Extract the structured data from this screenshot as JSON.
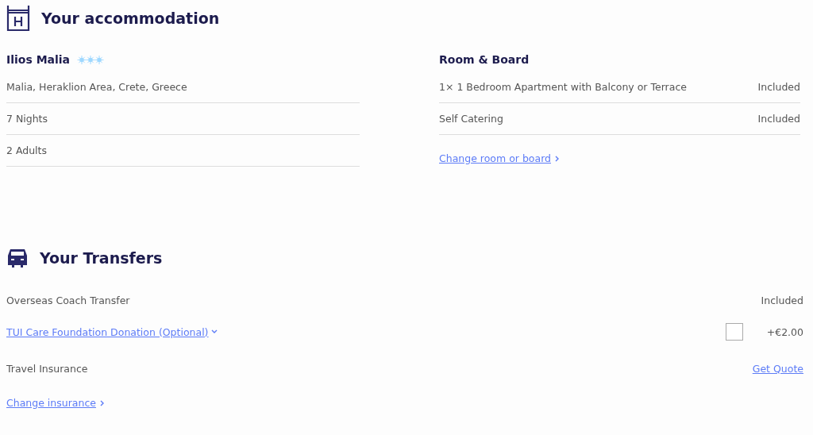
{
  "accommodation": {
    "title": "Your accommodation",
    "hotel": {
      "name": "Ilios Malia",
      "stars": 3
    },
    "details": [
      "Malia, Heraklion Area, Crete, Greece",
      "7 Nights",
      "2  Adults"
    ],
    "room_board": {
      "title": "Room & Board",
      "rows": [
        {
          "label": "1× 1 Bedroom Apartment with Balcony or Terrace",
          "value": "Included"
        },
        {
          "label": "Self Catering",
          "value": "Included"
        }
      ],
      "link": "Change room or board"
    }
  },
  "transfers": {
    "title": "Your Transfers",
    "rows": [
      {
        "kind": "plain",
        "label": "Overseas Coach Transfer",
        "value": "Included"
      },
      {
        "kind": "option",
        "label": "TUI Care Foundation Donation (Optional)",
        "value": "+€2.00",
        "checked": false
      },
      {
        "kind": "quote",
        "label": "Travel Insurance",
        "value": "Get Quote"
      }
    ],
    "link": "Change insurance"
  }
}
